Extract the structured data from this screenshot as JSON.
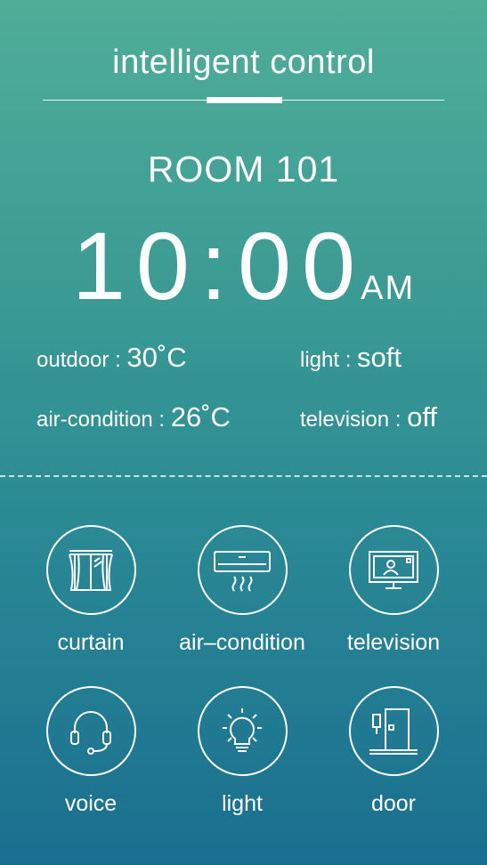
{
  "header": {
    "title": "intelligent control"
  },
  "room": "ROOM 101",
  "clock": {
    "time": "10:00",
    "ampm": "AM"
  },
  "stats": {
    "outdoor": {
      "label": "outdoor :",
      "value": "30˚C"
    },
    "light": {
      "label": "light :",
      "value": "soft"
    },
    "air_condition": {
      "label": "air-condition :",
      "value": "26˚C"
    },
    "television": {
      "label": "television :",
      "value": "off"
    }
  },
  "controls": [
    {
      "label": "curtain",
      "icon": "curtain-icon"
    },
    {
      "label": "air–condition",
      "icon": "air-conditioner-icon"
    },
    {
      "label": "television",
      "icon": "television-icon"
    },
    {
      "label": "voice",
      "icon": "headset-icon"
    },
    {
      "label": "light",
      "icon": "light-bulb-icon"
    },
    {
      "label": "door",
      "icon": "door-icon"
    }
  ]
}
